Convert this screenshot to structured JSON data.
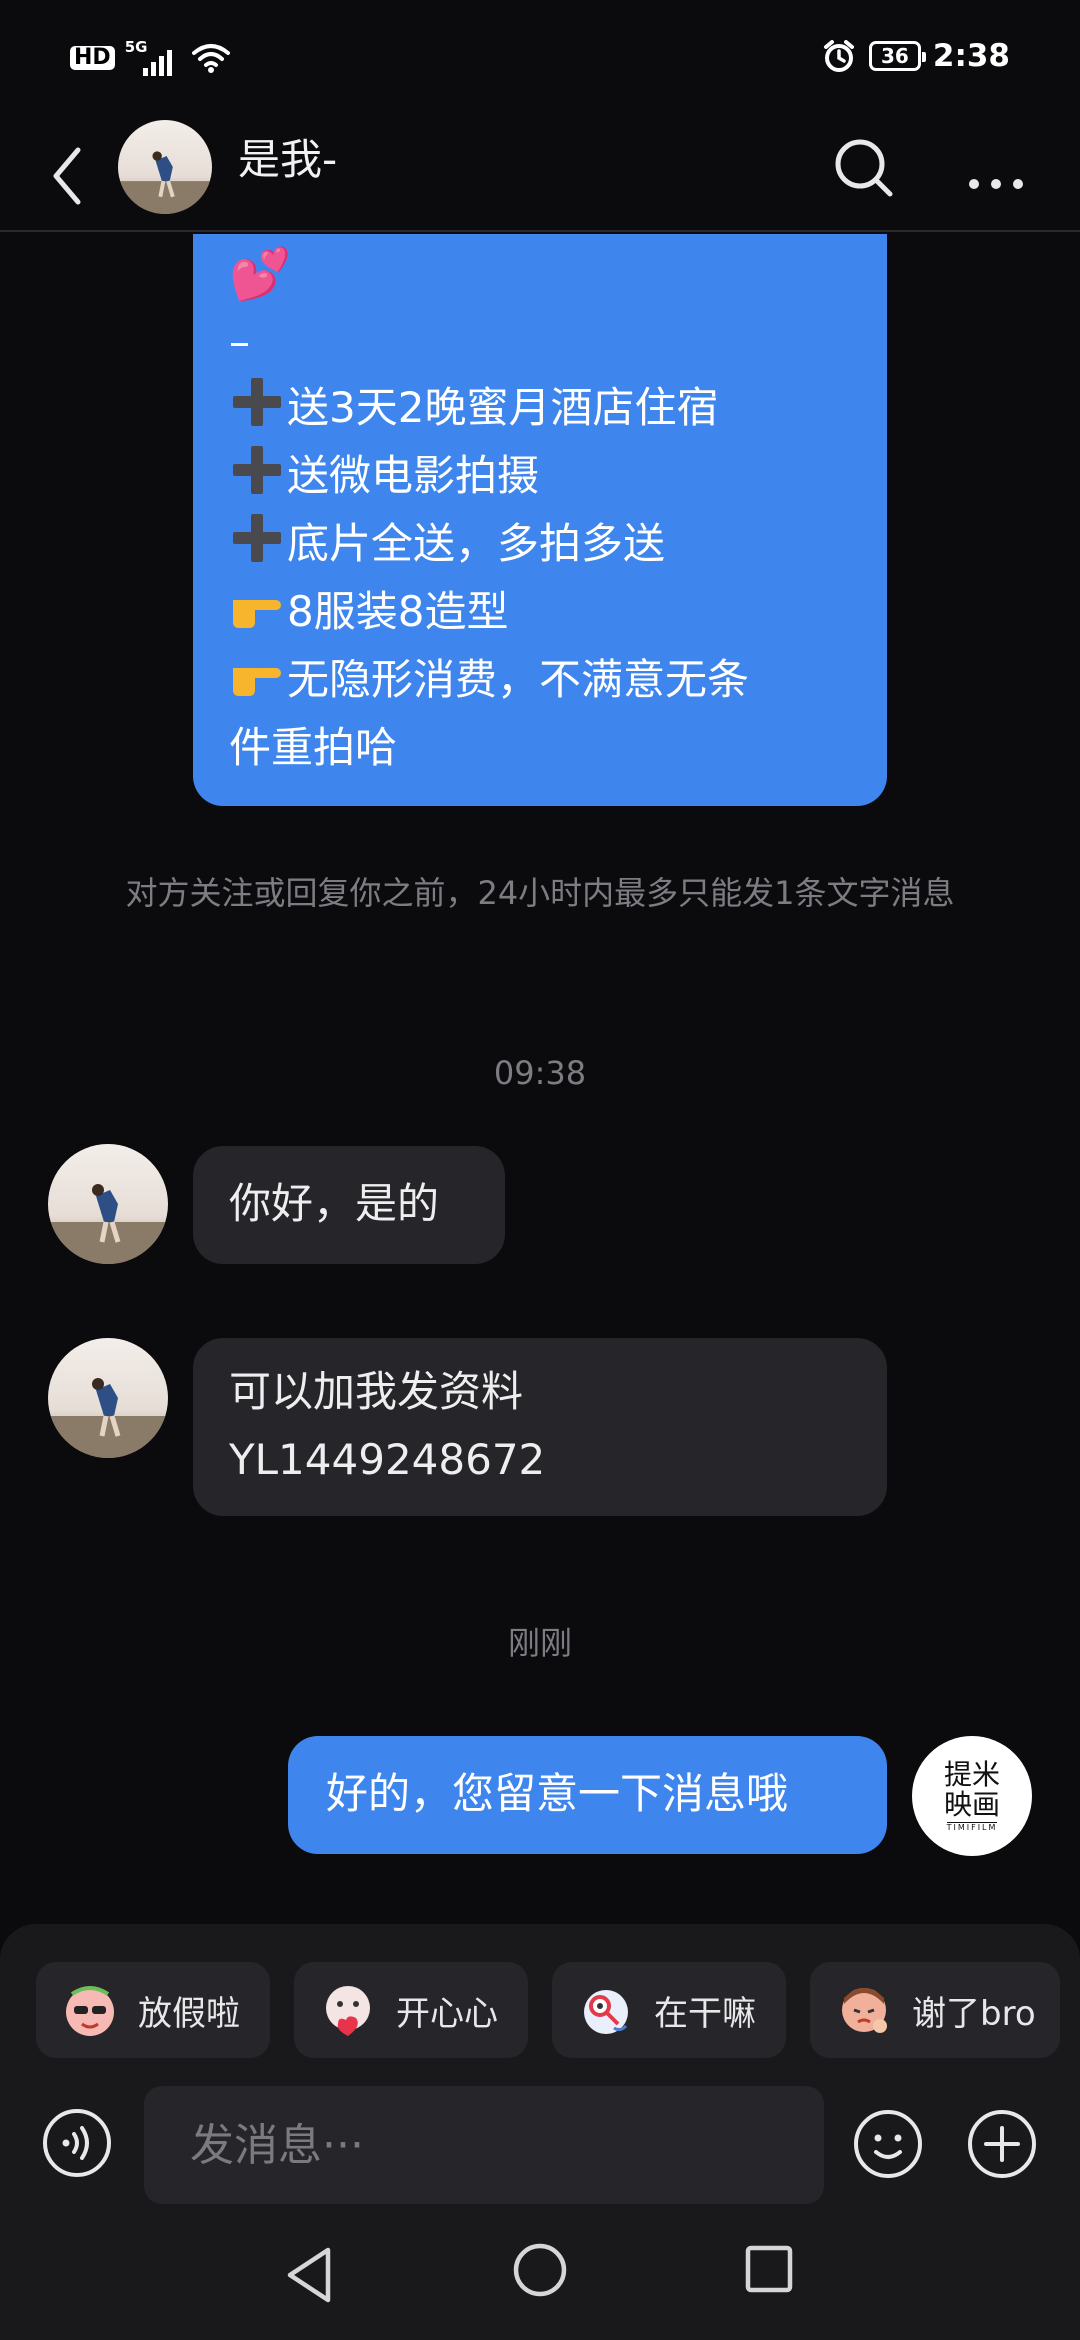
{
  "status_bar": {
    "hd": "HD",
    "network": "5G",
    "battery": "36",
    "time": "2:38"
  },
  "header": {
    "title": "是我-"
  },
  "promo_message": {
    "heart": "💕",
    "dash": "–",
    "lines": [
      "送3天2晚蜜月酒店住宿",
      "送微电影拍摄",
      "底片全送，多拍多送",
      "8服装8造型",
      "无隐形消费，不满意无条",
      "件重拍哈"
    ]
  },
  "system_notice": "对方关注或回复你之前，24小时内最多只能发1条文字消息",
  "timestamps": {
    "first": "09:38",
    "second": "刚刚"
  },
  "messages": {
    "reply_1": "你好，是的",
    "reply_2_line1": "可以加我发资料",
    "reply_2_line2": "YL1449248672",
    "mine": "好的，您留意一下消息哦"
  },
  "my_avatar": {
    "text": "提米映画",
    "sub": "TIMIFILM"
  },
  "quick_replies": [
    {
      "label": "放假啦",
      "icon": "vacation-sticker-icon"
    },
    {
      "label": "开心心",
      "icon": "happy-heart-sticker-icon"
    },
    {
      "label": "在干嘛",
      "icon": "peek-sticker-icon"
    },
    {
      "label": "谢了bro",
      "icon": "thanks-sticker-icon"
    }
  ],
  "input": {
    "placeholder": "发消息···"
  },
  "colors": {
    "background": "#0b0b0d",
    "my_bubble": "#3e86ee",
    "their_bubble": "#26262a",
    "panel": "#19191c"
  }
}
